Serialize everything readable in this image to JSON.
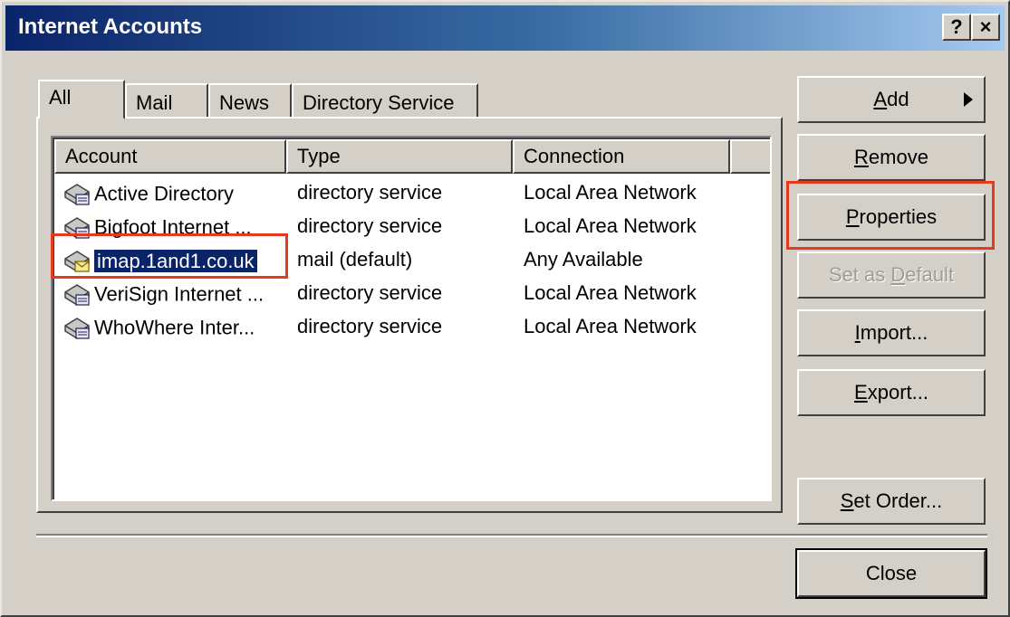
{
  "window": {
    "title": "Internet Accounts",
    "help_button": "?",
    "close_button": "×"
  },
  "tabs": [
    {
      "label": "All",
      "active": true
    },
    {
      "label": "Mail",
      "active": false
    },
    {
      "label": "News",
      "active": false
    },
    {
      "label": "Directory Service",
      "active": false
    }
  ],
  "list": {
    "columns": [
      "Account",
      "Type",
      "Connection"
    ],
    "rows": [
      {
        "account": "Active Directory",
        "type": "directory service",
        "connection": "Local Area Network",
        "icon": "directory-service-icon",
        "selected": false
      },
      {
        "account": "Bigfoot Internet ...",
        "type": "directory service",
        "connection": "Local Area Network",
        "icon": "directory-service-icon",
        "selected": false
      },
      {
        "account": "imap.1and1.co.uk",
        "type": "mail (default)",
        "connection": "Any Available",
        "icon": "mail-account-icon",
        "selected": true
      },
      {
        "account": "VeriSign Internet ...",
        "type": "directory service",
        "connection": "Local Area Network",
        "icon": "directory-service-icon",
        "selected": false
      },
      {
        "account": "WhoWhere Inter...",
        "type": "directory service",
        "connection": "Local Area Network",
        "icon": "directory-service-icon",
        "selected": false
      }
    ]
  },
  "buttons": {
    "add": {
      "mnemonic": "A",
      "rest": "dd"
    },
    "remove": {
      "mnemonic": "R",
      "rest": "emove"
    },
    "properties": {
      "mnemonic": "P",
      "rest": "roperties"
    },
    "set_default": {
      "before": "Set as ",
      "mnemonic": "D",
      "rest": "efault",
      "disabled": true
    },
    "import": {
      "mnemonic": "I",
      "rest": "mport..."
    },
    "export": {
      "mnemonic": "E",
      "rest": "xport..."
    },
    "set_order": {
      "mnemonic": "S",
      "rest": "et Order..."
    },
    "close": "Close"
  },
  "colors": {
    "highlight": "#e63a1e",
    "selection": "#0a246a",
    "face": "#d4d0c8"
  }
}
